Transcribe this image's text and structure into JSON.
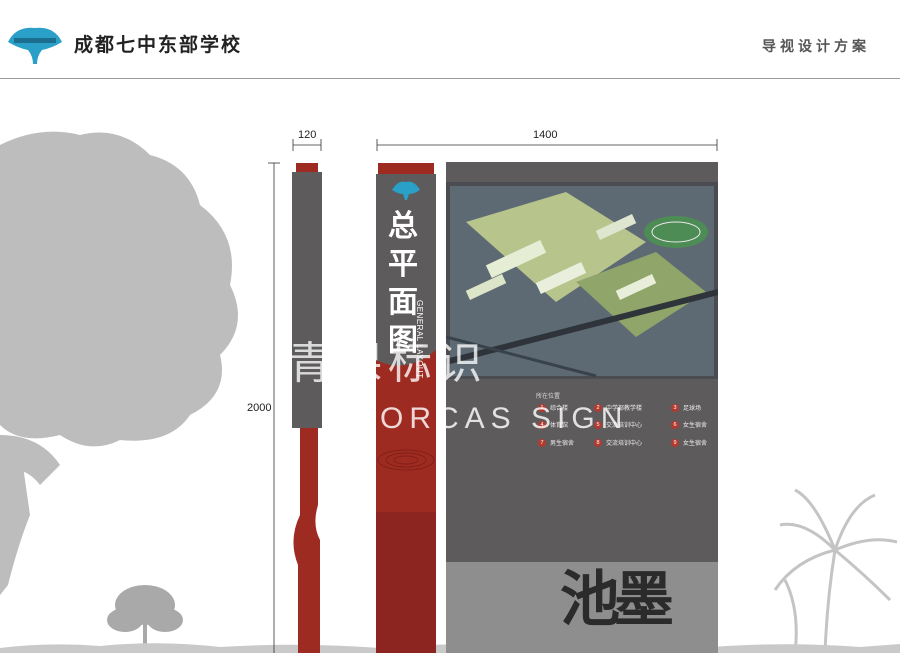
{
  "header": {
    "school_name": "成都七中东部学校",
    "doc_title": "导视设计方案",
    "logo_icon": "ginkgo-leaf-logo"
  },
  "dimensions": {
    "width_side": "120",
    "width_front": "1400",
    "height": "2000"
  },
  "sign": {
    "title_chars": [
      "总",
      "平",
      "面",
      "图"
    ],
    "subtitle": "GENERAL LAYOUT",
    "legend_title": "所在位置",
    "legend": [
      {
        "num": "1",
        "label": "综合楼"
      },
      {
        "num": "2",
        "label": "中学部教学楼"
      },
      {
        "num": "3",
        "label": "足球场"
      },
      {
        "num": "4",
        "label": "体育馆"
      },
      {
        "num": "5",
        "label": "交流培训中心"
      },
      {
        "num": "6",
        "label": "女生宿舍"
      },
      {
        "num": "7",
        "label": "男生宿舍"
      },
      {
        "num": "8",
        "label": "交流培训中心"
      },
      {
        "num": "9",
        "label": "女生宿舍"
      }
    ],
    "calligraphy": "池墨"
  },
  "watermark": {
    "cn": "青课标识",
    "en": "ORCAS SIGN"
  },
  "colors": {
    "panel_gray": "#5e5b5c",
    "accent_red": "#9e2b22",
    "tree_gray": "#b9b9b9"
  }
}
